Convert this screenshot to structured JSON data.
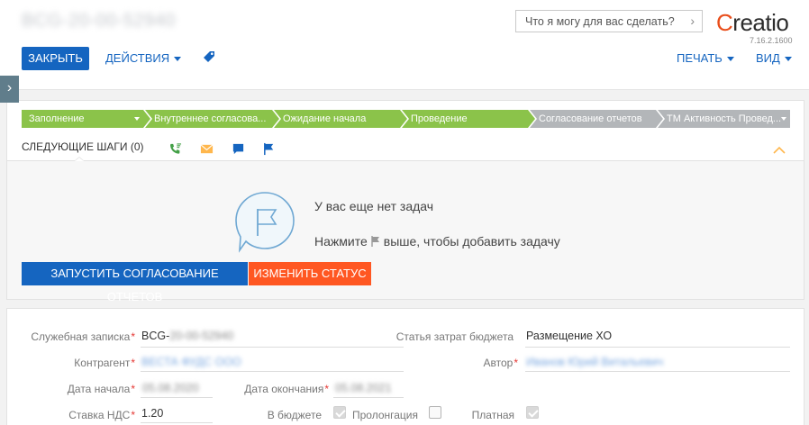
{
  "header": {
    "record_title": "BCG-20-00-52940",
    "search_placeholder": "Что я могу для вас сделать?",
    "logo_text": "Creatio",
    "version": "7.16.2.1600",
    "close_label": "ЗАКРЫТЬ",
    "actions_label": "ДЕЙСТВИЯ",
    "print_label": "ПЕЧАТЬ",
    "view_label": "ВИД"
  },
  "stages": [
    {
      "label": "Заполнение",
      "status": "done",
      "dropdown": true
    },
    {
      "label": "Внутреннее согласова...",
      "status": "done",
      "dropdown": false
    },
    {
      "label": "Ожидание начала",
      "status": "done",
      "dropdown": false
    },
    {
      "label": "Проведение",
      "status": "done",
      "dropdown": false
    },
    {
      "label": "Согласование отчетов",
      "status": "todo",
      "dropdown": false
    },
    {
      "label": "ТМ Активность Провед...",
      "status": "todo",
      "dropdown": true
    }
  ],
  "next_steps": {
    "label": "СЛЕДУЮЩИЕ ШАГИ (0)",
    "empty_title": "У вас еще нет задач",
    "hint_before": "Нажмите",
    "hint_after": "выше, чтобы добавить задачу"
  },
  "buttons": {
    "start_approval": "ЗАПУСТИТЬ СОГЛАСОВАНИЕ ОТЧЕТОВ",
    "change_status": "ИЗМЕНИТЬ СТАТУС"
  },
  "form": {
    "memo_label": "Служебная записка",
    "memo_value_prefix": "BCG-",
    "memo_value_hidden": "20-00-52940",
    "budget_item_label": "Статья затрат бюджета",
    "budget_item_value": "Размещение ХО",
    "counterparty_label": "Контрагент",
    "counterparty_value": "ВЕСТА ФУДС ООО",
    "author_label": "Автор",
    "author_value": "Иванов Юрий Витальевич",
    "start_date_label": "Дата начала",
    "start_date_value": "05.08.2020",
    "end_date_label": "Дата окончания",
    "end_date_value": "05.08.2021",
    "vat_label": "Ставка НДС",
    "vat_value": "1.20",
    "in_budget_label": "В бюджете",
    "in_budget_checked": true,
    "prolongation_label": "Пролонгация",
    "prolongation_checked": false,
    "paid_install_label": "Платная установка",
    "paid_install_checked": true
  },
  "colors": {
    "primary": "#1565c0",
    "accent": "#ff5722",
    "stage_done": "#8bc34a",
    "stage_todo": "#b3b6b9",
    "required": "#e53935"
  },
  "icons": {
    "call": "phone-icon",
    "email": "envelope-icon",
    "chat": "chat-icon",
    "task": "flag-icon",
    "tag": "tag-icon"
  }
}
